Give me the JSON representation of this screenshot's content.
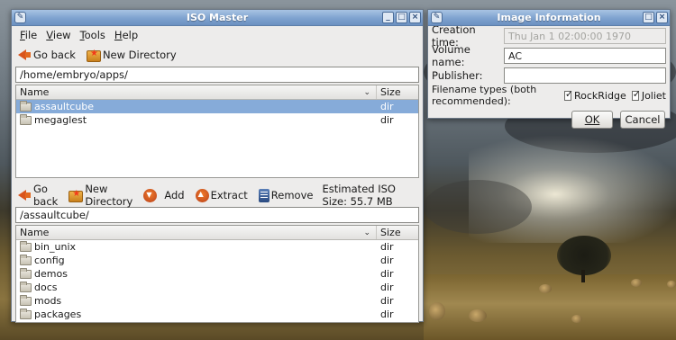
{
  "main_window": {
    "title": "ISO Master",
    "menu": [
      {
        "label": "File",
        "mnemonic": "F",
        "rest": "ile"
      },
      {
        "label": "View",
        "mnemonic": "V",
        "rest": "iew"
      },
      {
        "label": "Tools",
        "mnemonic": "T",
        "rest": "ools"
      },
      {
        "label": "Help",
        "mnemonic": "H",
        "rest": "elp"
      }
    ],
    "top_toolbar": {
      "go_back": "Go back",
      "new_directory": "New Directory"
    },
    "top_path": "/home/embryo/apps/",
    "top_list": {
      "headers": {
        "name": "Name",
        "size": "Size"
      },
      "rows": [
        {
          "name": "assaultcube",
          "size": "dir",
          "selected": true
        },
        {
          "name": "megaglest",
          "size": "dir",
          "selected": false
        }
      ]
    },
    "bottom_toolbar": {
      "go_back": "Go back",
      "new_directory": "New Directory",
      "add": "Add",
      "extract": "Extract",
      "remove": "Remove",
      "estimated_size": "Estimated ISO Size: 55.7 MB"
    },
    "bottom_path": "/assaultcube/",
    "bottom_list": {
      "headers": {
        "name": "Name",
        "size": "Size"
      },
      "rows": [
        {
          "name": "bin_unix",
          "size": "dir"
        },
        {
          "name": "config",
          "size": "dir"
        },
        {
          "name": "demos",
          "size": "dir"
        },
        {
          "name": "docs",
          "size": "dir"
        },
        {
          "name": "mods",
          "size": "dir"
        },
        {
          "name": "packages",
          "size": "dir"
        }
      ]
    }
  },
  "info_dialog": {
    "title": "Image Information",
    "creation_time_label": "Creation time:",
    "creation_time_value": "Thu Jan  1 02:00:00 1970",
    "volume_name_label": "Volume name:",
    "volume_name_value": "AC",
    "publisher_label": "Publisher:",
    "publisher_value": "",
    "filename_types_label": "Filename types (both recommended):",
    "rockridge_label": "RockRidge",
    "rockridge_checked": true,
    "joliet_label": "Joliet",
    "joliet_checked": true,
    "ok_label": "OK",
    "cancel_label": "Cancel"
  },
  "colors": {
    "titlebar": "#7ea2cf",
    "selection": "#86abd9",
    "window_bg": "#edeceb"
  }
}
